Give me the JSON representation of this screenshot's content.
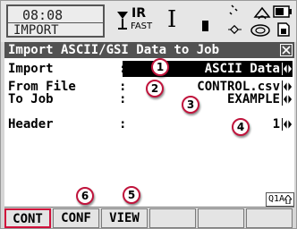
{
  "status_bar": {
    "time": "08:08",
    "mode": "IMPORT",
    "measure_mode": "IR",
    "measure_speed": "FAST",
    "icons": [
      "prism-icon",
      "cursor-icon",
      "battery-small-icon",
      "satellite-icon",
      "rotate-icon",
      "battery-icon",
      "memory-card-icon"
    ]
  },
  "dialog": {
    "title": "Import ASCII/GSI Data to Job",
    "close_icon": "close-icon"
  },
  "fields": [
    {
      "label": "Import",
      "colon": ":",
      "value": "ASCII Data",
      "selected": true
    },
    {
      "label": "From File",
      "colon": ":",
      "value": "CONTROL.csv",
      "selected": false
    },
    {
      "label": "To Job",
      "colon": ":",
      "value": "EXAMPLE",
      "selected": false
    },
    {
      "label": "Header",
      "colon": ":",
      "value": "1",
      "selected": false
    }
  ],
  "input_mode": "Q1A",
  "input_mode_icon": "shift-arrow-icon",
  "softkeys": [
    {
      "label": "CONT"
    },
    {
      "label": "CONF"
    },
    {
      "label": "VIEW"
    },
    {
      "label": ""
    },
    {
      "label": ""
    },
    {
      "label": ""
    }
  ],
  "callouts": [
    "1",
    "2",
    "3",
    "4",
    "5",
    "6"
  ],
  "colors": {
    "title_bar": "#525252",
    "selection": "#000000",
    "callout_border": "#c0143c",
    "softkey_highlight": "#d0103a"
  }
}
